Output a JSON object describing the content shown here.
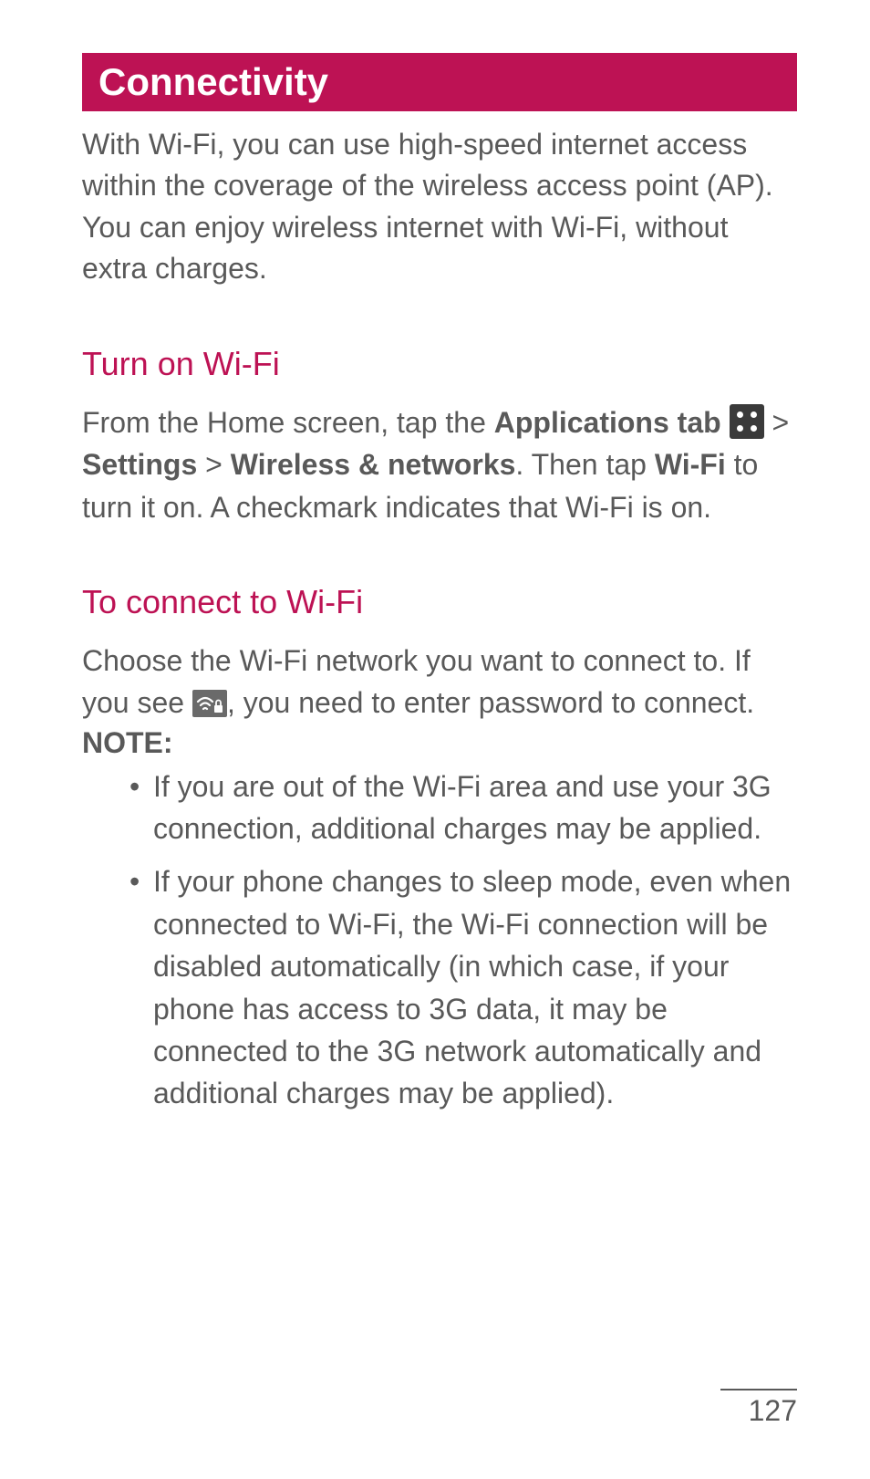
{
  "title": "Connectivity",
  "intro": "With Wi-Fi, you can use high-speed internet access within the coverage of the wireless access point (AP). You can enjoy wireless internet with Wi-Fi, without extra charges.",
  "section1": {
    "heading": "Turn on Wi-Fi",
    "text_before_icon": "From the Home screen, tap the ",
    "apps_tab": "Applications tab",
    "gt1": " > ",
    "settings": "Settings",
    "gt2": " > ",
    "wireless": "Wireless & networks",
    "then_tap": ". Then tap ",
    "wifi": "Wi-Fi",
    "rest": " to turn it on. A checkmark indicates that Wi-Fi is on."
  },
  "section2": {
    "heading": "To connect to Wi-Fi",
    "p1a": "Choose the Wi-Fi network you want to connect to. If you see ",
    "p1b": ", you need to enter password to connect.",
    "note_label": "NOTE:",
    "notes": [
      "If you are out of the Wi-Fi area and use your 3G connection, additional charges may be applied.",
      "If your phone changes to sleep mode, even when connected to Wi-Fi, the Wi-Fi connection will be disabled automatically (in which case, if your phone has access to 3G data, it may be connected to the 3G network automatically and additional charges may be applied)."
    ]
  },
  "page_number": "127"
}
